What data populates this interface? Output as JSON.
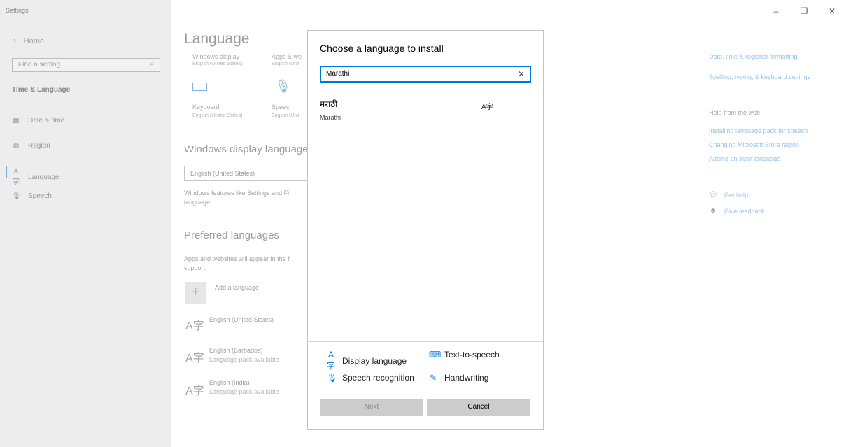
{
  "window": {
    "app_title": "Settings",
    "controls": {
      "minimize": "–",
      "restore": "❐",
      "close": "✕"
    }
  },
  "sidebar": {
    "home_label": "Home",
    "search_placeholder": "Find a setting",
    "section_label": "Time & Language",
    "items": [
      {
        "label": "Date & time",
        "icon": "calendar-clock-icon"
      },
      {
        "label": "Region",
        "icon": "globe-icon"
      },
      {
        "label": "Language",
        "icon": "language-icon"
      },
      {
        "label": "Speech",
        "icon": "microphone-icon"
      }
    ]
  },
  "main": {
    "page_title": "Language",
    "tiles": [
      {
        "top": "Windows display",
        "sub": "English (United States)"
      },
      {
        "top": "Apps & we",
        "sub": "English (Unit"
      },
      {
        "top": "Keyboard",
        "sub": "English (United States)"
      },
      {
        "top": "Speech",
        "sub": "English (Unit"
      }
    ],
    "display_heading": "Windows display language",
    "display_value": "English (United States)",
    "display_note_1": "Windows features like Settings and Fi",
    "display_note_2": "language.",
    "preferred_heading": "Preferred languages",
    "preferred_note_1": "Apps and websites will appear in the f",
    "preferred_note_2": "support.",
    "add_language_label": "Add a language",
    "languages": [
      {
        "name": "English (United States)",
        "sub": ""
      },
      {
        "name": "English (Barbados)",
        "sub": "Language pack available"
      },
      {
        "name": "English (India)",
        "sub": "Language pack available"
      }
    ]
  },
  "right_panel": {
    "links_top": [
      "Date, time & regional formatting",
      "Spelling, typing, & keyboard settings"
    ],
    "help_heading": "Help from the web",
    "help_links": [
      "Installing language pack for speech",
      "Changing Microsoft Store region",
      "Adding an input language"
    ],
    "get_help": "Get help",
    "give_feedback": "Give feedback"
  },
  "dialog": {
    "title": "Choose a language to install",
    "search_value": "Marathi",
    "clear_icon": "✕",
    "result": {
      "native": "मराठी",
      "english": "Marathi",
      "feature_icon": "display-language-icon"
    },
    "features": [
      {
        "label": "Display language",
        "icon": "display-language-icon"
      },
      {
        "label": "Text-to-speech",
        "icon": "text-to-speech-icon"
      },
      {
        "label": "Speech recognition",
        "icon": "microphone-icon"
      },
      {
        "label": "Handwriting",
        "icon": "handwriting-icon"
      }
    ],
    "next_label": "Next",
    "cancel_label": "Cancel"
  },
  "colors": {
    "accent": "#0078d7",
    "link": "#9cc2e8",
    "sidebar_bg": "#ededed"
  }
}
